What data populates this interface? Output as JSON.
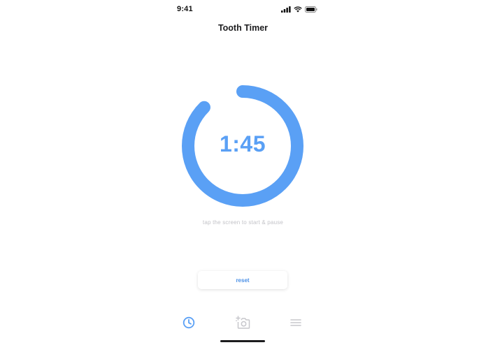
{
  "status_bar": {
    "time": "9:41",
    "icons": [
      "signal-icon",
      "wifi-icon",
      "battery-icon"
    ]
  },
  "header": {
    "title": "Tooth Timer"
  },
  "timer": {
    "display": "1:45",
    "progress_fraction": 0.875,
    "hint": "tap the screen to start & pause"
  },
  "controls": {
    "reset_label": "reset"
  },
  "tab_bar": {
    "tabs": [
      {
        "icon": "clock-icon",
        "active": true
      },
      {
        "icon": "add-photo-icon",
        "active": false
      },
      {
        "icon": "menu-icon",
        "active": false
      }
    ]
  },
  "colors": {
    "accent": "#5aa0f5",
    "hint_text": "#c3c3c8",
    "inactive_icon": "#c7c7cc"
  }
}
